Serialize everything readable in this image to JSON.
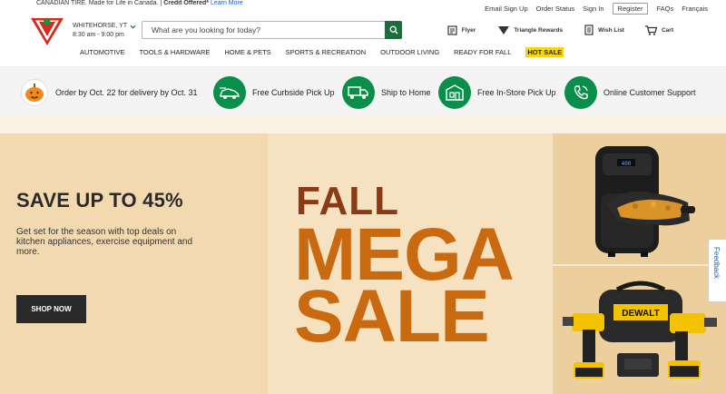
{
  "header": {
    "brand_line": "CANADIAN TIRE. Made for Life in Canada.",
    "credit": "Credit Offered*",
    "learn_more": "Learn More",
    "store_city": "WHITEHORSE, YT",
    "store_hours": "8:30 am - 9:00 pm",
    "search_placeholder": "What are you looking for today?",
    "utility": [
      "Email Sign Up",
      "Order Status",
      "Sign In",
      "Register",
      "FAQs",
      "Français"
    ],
    "tools": {
      "flyer": "Flyer",
      "triangle": "Triangle Rewards",
      "wishlist": "Wish List",
      "cart": "Cart"
    },
    "nav": [
      "AUTOMOTIVE",
      "TOOLS & HARDWARE",
      "HOME & PETS",
      "SPORTS & RECREATION",
      "OUTDOOR LIVING",
      "READY FOR FALL",
      "HOT SALE"
    ]
  },
  "services": [
    {
      "label": "Order by Oct. 22 for delivery by Oct. 31",
      "icon": "pumpkin-icon"
    },
    {
      "label": "Free Curbside Pick Up",
      "icon": "curbside-car-icon"
    },
    {
      "label": "Ship to Home",
      "icon": "delivery-truck-icon"
    },
    {
      "label": "Free In-Store Pick Up",
      "icon": "store-icon"
    },
    {
      "label": "Online Customer Support",
      "icon": "phone-support-icon"
    }
  ],
  "hero": {
    "headline": "SAVE UP TO 45%",
    "description": "Get set for the season with top deals on kitchen appliances, exercise equipment and more.",
    "cta": "SHOP NOW",
    "big_1": "FALL",
    "big_2": "MEGA",
    "big_3": "SALE",
    "right_top": "air-fryer-image",
    "right_bottom": "dewalt-drill-kit-image",
    "right_bottom_label": "DEWALT"
  },
  "feedback": "Feedback",
  "colors": {
    "brand_red": "#d52b1e",
    "green": "#0a8f4a",
    "hot_sale": "#f4d519",
    "mega_orange": "#c96a10",
    "fall_brown": "#8a3a14"
  }
}
